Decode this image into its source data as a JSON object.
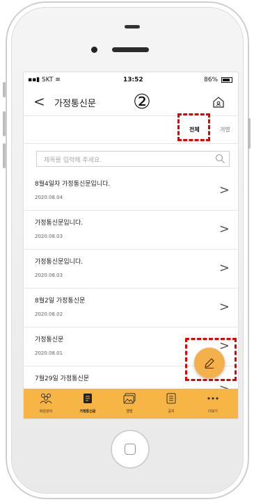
{
  "status_bar": {
    "carrier": "SKT",
    "time": "13:52",
    "battery": "86%"
  },
  "header": {
    "back_symbol": "<",
    "title": "가정통신문",
    "step_number": "②"
  },
  "tabs": [
    {
      "label": "전체",
      "active": true
    },
    {
      "label": "개별",
      "active": false
    }
  ],
  "search": {
    "placeholder": "제목를 입력해 주세요."
  },
  "items": [
    {
      "title": "8월4일자 가정통신문입니다.",
      "date": "2020.08.04"
    },
    {
      "title": "가정통신문입니다.",
      "date": "2020.08.03"
    },
    {
      "title": "가정통신문입니다.",
      "date": "2020.08.03"
    },
    {
      "title": "8월2일 가정통신문",
      "date": "2020.08.02"
    },
    {
      "title": "가정통신문",
      "date": "2020.08.01"
    },
    {
      "title": "7월29일 가정통신문",
      "date": ""
    }
  ],
  "bottom_nav": [
    {
      "label": "회원관리",
      "icon": "people-icon",
      "active": false
    },
    {
      "label": "가정통신문",
      "icon": "document-icon",
      "active": true
    },
    {
      "label": "앨범",
      "icon": "album-icon",
      "active": false
    },
    {
      "label": "공지",
      "icon": "notice-icon",
      "active": false
    },
    {
      "label": "더보기",
      "icon": "more-icon",
      "active": false
    }
  ],
  "colors": {
    "accent": "#f7b545",
    "highlight": "#e40000",
    "fab": "#f4b04a"
  }
}
